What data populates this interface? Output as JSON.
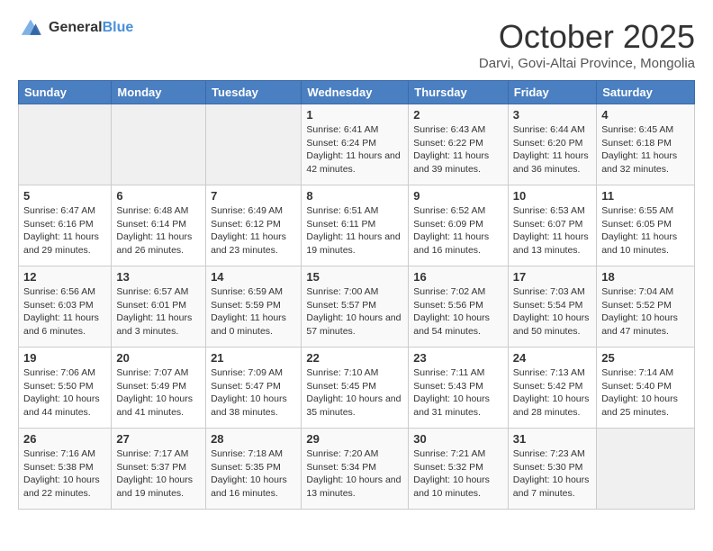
{
  "header": {
    "logo_general": "General",
    "logo_blue": "Blue",
    "month": "October 2025",
    "location": "Darvi, Govi-Altai Province, Mongolia"
  },
  "days_of_week": [
    "Sunday",
    "Monday",
    "Tuesday",
    "Wednesday",
    "Thursday",
    "Friday",
    "Saturday"
  ],
  "weeks": [
    [
      {
        "day": "",
        "sunrise": "",
        "sunset": "",
        "daylight": ""
      },
      {
        "day": "",
        "sunrise": "",
        "sunset": "",
        "daylight": ""
      },
      {
        "day": "",
        "sunrise": "",
        "sunset": "",
        "daylight": ""
      },
      {
        "day": "1",
        "sunrise": "6:41 AM",
        "sunset": "6:24 PM",
        "daylight": "11 hours and 42 minutes."
      },
      {
        "day": "2",
        "sunrise": "6:43 AM",
        "sunset": "6:22 PM",
        "daylight": "11 hours and 39 minutes."
      },
      {
        "day": "3",
        "sunrise": "6:44 AM",
        "sunset": "6:20 PM",
        "daylight": "11 hours and 36 minutes."
      },
      {
        "day": "4",
        "sunrise": "6:45 AM",
        "sunset": "6:18 PM",
        "daylight": "11 hours and 32 minutes."
      }
    ],
    [
      {
        "day": "5",
        "sunrise": "6:47 AM",
        "sunset": "6:16 PM",
        "daylight": "11 hours and 29 minutes."
      },
      {
        "day": "6",
        "sunrise": "6:48 AM",
        "sunset": "6:14 PM",
        "daylight": "11 hours and 26 minutes."
      },
      {
        "day": "7",
        "sunrise": "6:49 AM",
        "sunset": "6:12 PM",
        "daylight": "11 hours and 23 minutes."
      },
      {
        "day": "8",
        "sunrise": "6:51 AM",
        "sunset": "6:11 PM",
        "daylight": "11 hours and 19 minutes."
      },
      {
        "day": "9",
        "sunrise": "6:52 AM",
        "sunset": "6:09 PM",
        "daylight": "11 hours and 16 minutes."
      },
      {
        "day": "10",
        "sunrise": "6:53 AM",
        "sunset": "6:07 PM",
        "daylight": "11 hours and 13 minutes."
      },
      {
        "day": "11",
        "sunrise": "6:55 AM",
        "sunset": "6:05 PM",
        "daylight": "11 hours and 10 minutes."
      }
    ],
    [
      {
        "day": "12",
        "sunrise": "6:56 AM",
        "sunset": "6:03 PM",
        "daylight": "11 hours and 6 minutes."
      },
      {
        "day": "13",
        "sunrise": "6:57 AM",
        "sunset": "6:01 PM",
        "daylight": "11 hours and 3 minutes."
      },
      {
        "day": "14",
        "sunrise": "6:59 AM",
        "sunset": "5:59 PM",
        "daylight": "11 hours and 0 minutes."
      },
      {
        "day": "15",
        "sunrise": "7:00 AM",
        "sunset": "5:57 PM",
        "daylight": "10 hours and 57 minutes."
      },
      {
        "day": "16",
        "sunrise": "7:02 AM",
        "sunset": "5:56 PM",
        "daylight": "10 hours and 54 minutes."
      },
      {
        "day": "17",
        "sunrise": "7:03 AM",
        "sunset": "5:54 PM",
        "daylight": "10 hours and 50 minutes."
      },
      {
        "day": "18",
        "sunrise": "7:04 AM",
        "sunset": "5:52 PM",
        "daylight": "10 hours and 47 minutes."
      }
    ],
    [
      {
        "day": "19",
        "sunrise": "7:06 AM",
        "sunset": "5:50 PM",
        "daylight": "10 hours and 44 minutes."
      },
      {
        "day": "20",
        "sunrise": "7:07 AM",
        "sunset": "5:49 PM",
        "daylight": "10 hours and 41 minutes."
      },
      {
        "day": "21",
        "sunrise": "7:09 AM",
        "sunset": "5:47 PM",
        "daylight": "10 hours and 38 minutes."
      },
      {
        "day": "22",
        "sunrise": "7:10 AM",
        "sunset": "5:45 PM",
        "daylight": "10 hours and 35 minutes."
      },
      {
        "day": "23",
        "sunrise": "7:11 AM",
        "sunset": "5:43 PM",
        "daylight": "10 hours and 31 minutes."
      },
      {
        "day": "24",
        "sunrise": "7:13 AM",
        "sunset": "5:42 PM",
        "daylight": "10 hours and 28 minutes."
      },
      {
        "day": "25",
        "sunrise": "7:14 AM",
        "sunset": "5:40 PM",
        "daylight": "10 hours and 25 minutes."
      }
    ],
    [
      {
        "day": "26",
        "sunrise": "7:16 AM",
        "sunset": "5:38 PM",
        "daylight": "10 hours and 22 minutes."
      },
      {
        "day": "27",
        "sunrise": "7:17 AM",
        "sunset": "5:37 PM",
        "daylight": "10 hours and 19 minutes."
      },
      {
        "day": "28",
        "sunrise": "7:18 AM",
        "sunset": "5:35 PM",
        "daylight": "10 hours and 16 minutes."
      },
      {
        "day": "29",
        "sunrise": "7:20 AM",
        "sunset": "5:34 PM",
        "daylight": "10 hours and 13 minutes."
      },
      {
        "day": "30",
        "sunrise": "7:21 AM",
        "sunset": "5:32 PM",
        "daylight": "10 hours and 10 minutes."
      },
      {
        "day": "31",
        "sunrise": "7:23 AM",
        "sunset": "5:30 PM",
        "daylight": "10 hours and 7 minutes."
      },
      {
        "day": "",
        "sunrise": "",
        "sunset": "",
        "daylight": ""
      }
    ]
  ]
}
